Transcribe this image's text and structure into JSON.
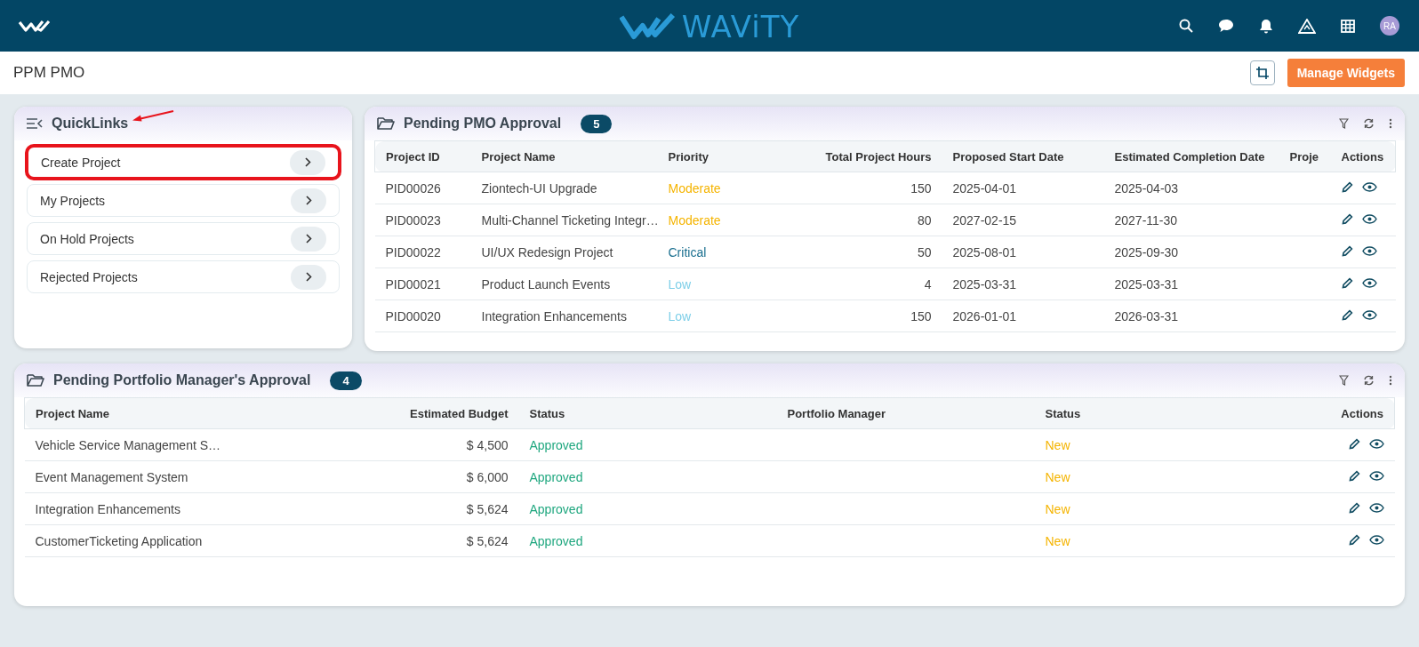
{
  "header": {
    "brand": "WAViTY",
    "avatar": "RA"
  },
  "page": {
    "title": "PPM PMO",
    "manage_button": "Manage Widgets"
  },
  "quicklinks": {
    "title": "QuickLinks",
    "items": [
      {
        "label": "Create Project",
        "highlighted": true
      },
      {
        "label": "My Projects",
        "highlighted": false
      },
      {
        "label": "On Hold Projects",
        "highlighted": false
      },
      {
        "label": "Rejected Projects",
        "highlighted": false
      }
    ]
  },
  "pmo_approval": {
    "title": "Pending PMO Approval",
    "count": "5",
    "columns": [
      "Project ID",
      "Project Name",
      "Priority",
      "Total Project Hours",
      "Proposed Start Date",
      "Estimated Completion Date",
      "Proje",
      "Actions"
    ],
    "rows": [
      {
        "id": "PID00026",
        "name": "Ziontech-UI Upgrade",
        "priority": "Moderate",
        "color": "#f5b400",
        "hours": "150",
        "start": "2025-04-01",
        "end": "2025-04-03"
      },
      {
        "id": "PID00023",
        "name": "Multi-Channel Ticketing Integr…",
        "priority": "Moderate",
        "color": "#f5b400",
        "hours": "80",
        "start": "2027-02-15",
        "end": "2027-11-30"
      },
      {
        "id": "PID00022",
        "name": "UI/UX Redesign Project",
        "priority": "Critical",
        "color": "#1a6f8f",
        "hours": "50",
        "start": "2025-08-01",
        "end": "2025-09-30"
      },
      {
        "id": "PID00021",
        "name": "Product Launch Events",
        "priority": "Low",
        "color": "#7ecfe8",
        "hours": "4",
        "start": "2025-03-31",
        "end": "2025-03-31"
      },
      {
        "id": "PID00020",
        "name": "Integration Enhancements",
        "priority": "Low",
        "color": "#7ecfe8",
        "hours": "150",
        "start": "2026-01-01",
        "end": "2026-03-31"
      }
    ]
  },
  "portfolio_approval": {
    "title": "Pending Portfolio Manager's Approval",
    "count": "4",
    "columns": [
      "Project Name",
      "Estimated Budget",
      "Status",
      "Portfolio Manager",
      "Status",
      "Actions"
    ],
    "rows": [
      {
        "name": "Vehicle Service Management S…",
        "budget": "$ 4,500",
        "status": "Approved",
        "manager_status": "New"
      },
      {
        "name": "Event Management System",
        "budget": "$ 6,000",
        "status": "Approved",
        "manager_status": "New"
      },
      {
        "name": "Integration Enhancements",
        "budget": "$ 5,624",
        "status": "Approved",
        "manager_status": "New"
      },
      {
        "name": "CustomerTicketing Application",
        "budget": "$ 5,624",
        "status": "Approved",
        "manager_status": "New"
      }
    ]
  }
}
